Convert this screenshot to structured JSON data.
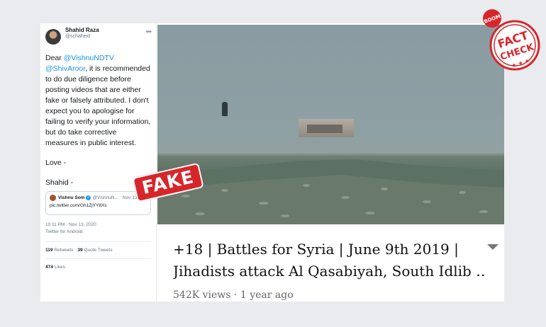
{
  "tweet": {
    "display_name": "Shahid Raza",
    "handle": "@schaheid",
    "more": "•••",
    "dear": "Dear",
    "mention1": "@VishnuNDTV",
    "mention2": "@ShivAroor",
    "text1": ", it is recommended to do due diligence before posting videos that are either fake or falsely attributed. I don't expect you to apologise for failing to verify your information, but do take corrective measures in public interest.",
    "love": "Love -",
    "signoff": "Shahid -",
    "quote": {
      "name": "Vishnu Som",
      "handle": "@VishnuN...",
      "date": "· Nov 13",
      "link": "pic.twitter.com/Gh1ZjYY8Xs"
    },
    "timestamp": "10:11 PM · Nov 13, 2020",
    "source": "Twitter for Android",
    "retweets_count": "119",
    "retweets_label": "Retweets",
    "quotes_count": "39",
    "quotes_label": "Quote Tweets",
    "likes_count": "474",
    "likes_label": "Likes"
  },
  "video": {
    "title_line1": "+18 | Battles for Syria | June 9th 2019 |",
    "title_line2": "Jihadists attack Al Qasabiyah, South Idlib …",
    "views": "542K views",
    "age": "1 year ago"
  },
  "stamp": {
    "fake": "FAKE"
  },
  "badge": {
    "top": "BOOM",
    "fact": "FACT",
    "check": "CHECK"
  },
  "colors": {
    "accent_red": "#d7262b",
    "mention_blue": "#1b95e0"
  }
}
